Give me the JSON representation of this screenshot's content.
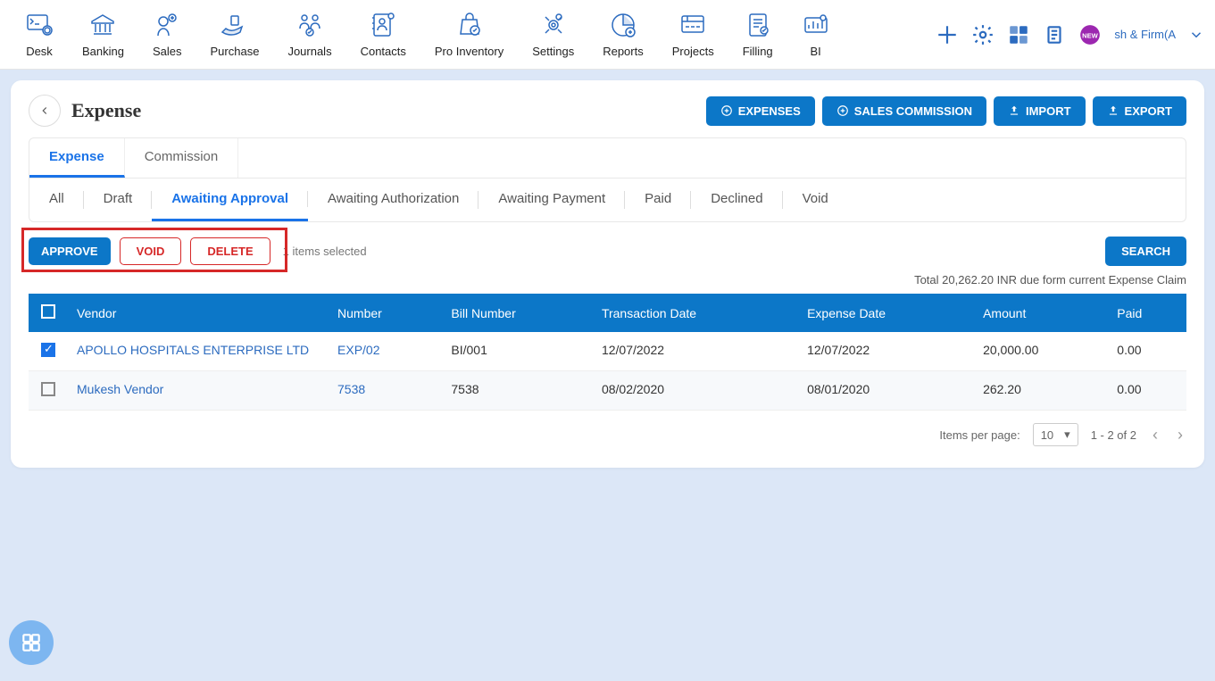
{
  "nav": {
    "items": [
      "Desk",
      "Banking",
      "Sales",
      "Purchase",
      "Journals",
      "Contacts",
      "Pro Inventory",
      "Settings",
      "Reports",
      "Projects",
      "Filling",
      "BI"
    ],
    "firm": "sh & Firm(A"
  },
  "page": {
    "title": "Expense",
    "actions": {
      "expenses": "EXPENSES",
      "salesCommission": "SALES COMMISSION",
      "import": "IMPORT",
      "export": "EXPORT"
    }
  },
  "tabsMain": {
    "items": [
      "Expense",
      "Commission"
    ],
    "activeIndex": 0
  },
  "filterTabs": {
    "items": [
      "All",
      "Draft",
      "Awaiting Approval",
      "Awaiting Authorization",
      "Awaiting Payment",
      "Paid",
      "Declined",
      "Void"
    ],
    "activeIndex": 2
  },
  "actions": {
    "approve": "APPROVE",
    "void": "VOID",
    "delete": "DELETE",
    "selectedText": "1 items selected",
    "search": "SEARCH"
  },
  "summary": "Total 20,262.20 INR due form current Expense Claim",
  "table": {
    "headers": [
      "Vendor",
      "Number",
      "Bill Number",
      "Transaction Date",
      "Expense Date",
      "Amount",
      "Paid"
    ],
    "rows": [
      {
        "checked": true,
        "vendor": "APOLLO HOSPITALS ENTERPRISE LTD",
        "number": "EXP/02",
        "bill": "BI/001",
        "txn": "12/07/2022",
        "exp": "12/07/2022",
        "amount": "20,000.00",
        "paid": "0.00"
      },
      {
        "checked": false,
        "vendor": "Mukesh Vendor",
        "number": "7538",
        "bill": "7538",
        "txn": "08/02/2020",
        "exp": "08/01/2020",
        "amount": "262.20",
        "paid": "0.00"
      }
    ]
  },
  "pagination": {
    "label": "Items per page:",
    "size": "10",
    "range": "1 - 2 of 2"
  }
}
